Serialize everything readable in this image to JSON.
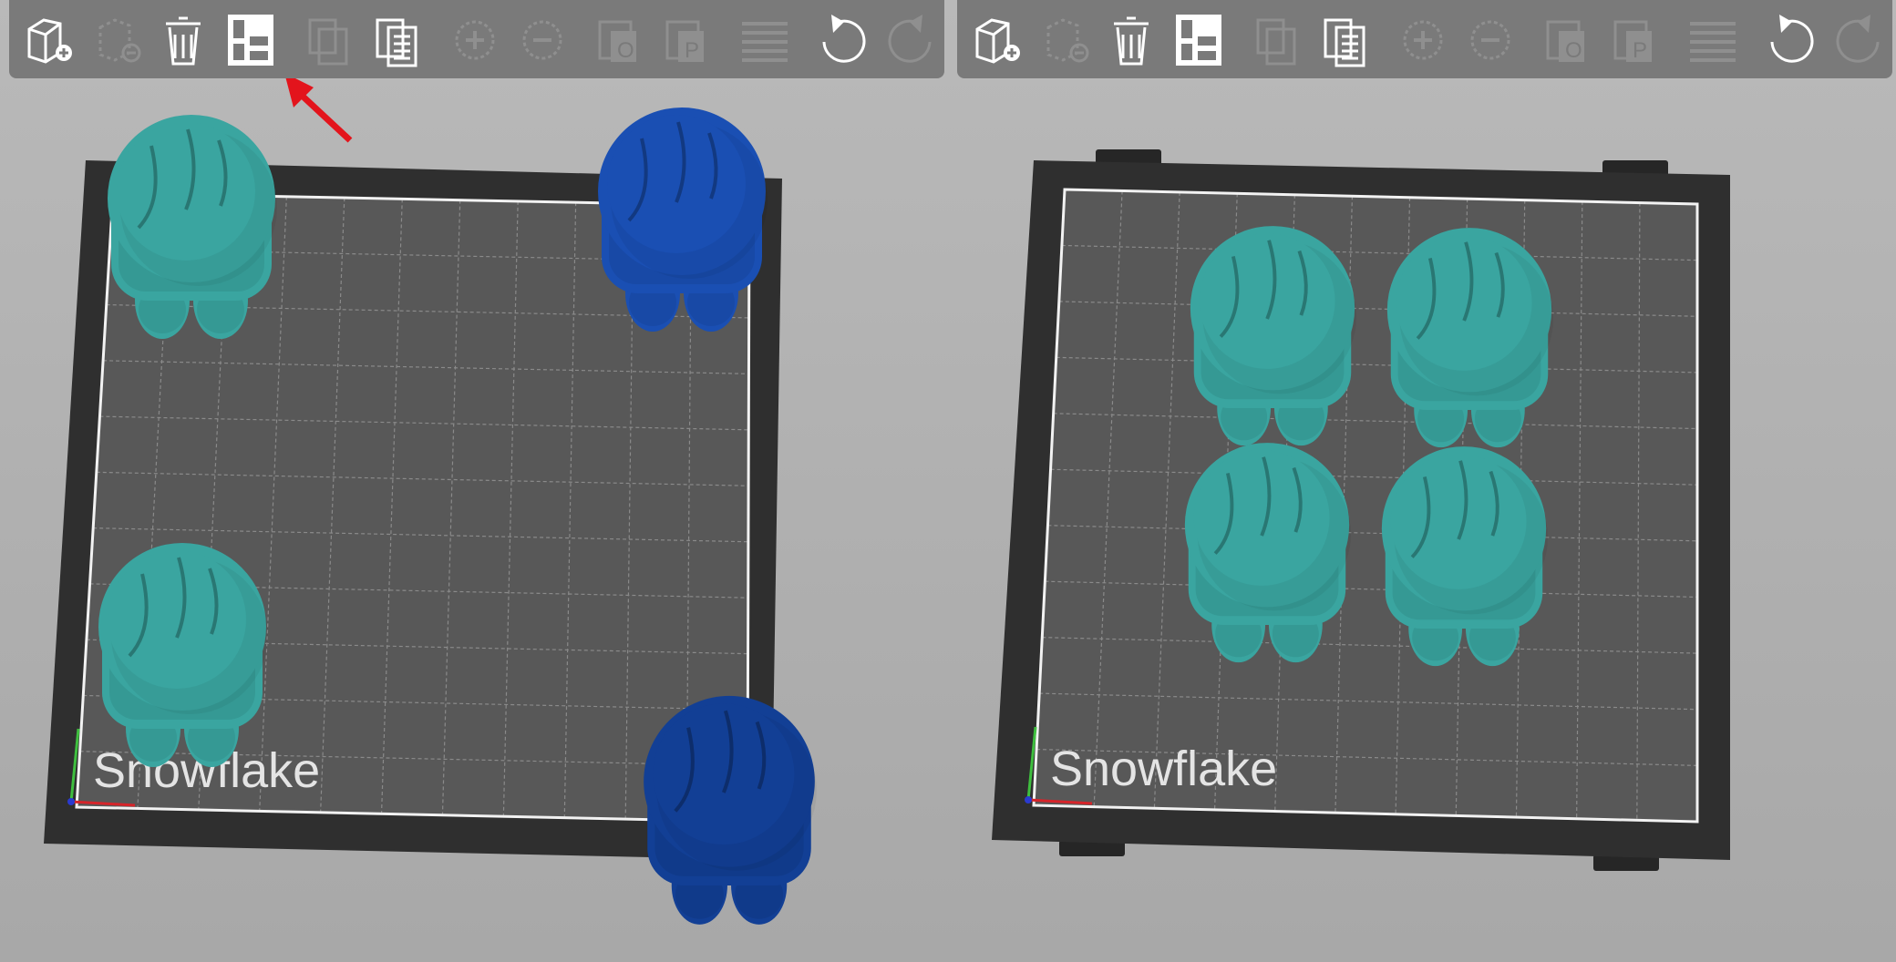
{
  "colors": {
    "background": "#b0b0b0",
    "toolbar": "#7a7a7a",
    "icon_active": "#ffffff",
    "icon_disabled": "#8f8f8f",
    "bed_frame": "#2f2f2f",
    "bed_surface": "#585858",
    "grid": "#8a8a8a",
    "model_teal": "#3aa5a0",
    "model_blue": "#1a4fb3",
    "annotation_arrow": "#e3141c"
  },
  "toolbar_icons": [
    {
      "name": "add-object-icon",
      "enabled": true
    },
    {
      "name": "remove-object-icon",
      "enabled": false
    },
    {
      "name": "delete-all-icon",
      "enabled": true
    },
    {
      "name": "arrange-icon",
      "enabled": true
    },
    {
      "name": "copy-icon",
      "enabled": false
    },
    {
      "name": "paste-icon",
      "enabled": true
    },
    {
      "name": "add-instance-icon",
      "enabled": false
    },
    {
      "name": "remove-instance-icon",
      "enabled": false
    },
    {
      "name": "split-objects-icon",
      "enabled": false
    },
    {
      "name": "split-parts-icon",
      "enabled": false
    },
    {
      "name": "layers-editing-icon",
      "enabled": false
    },
    {
      "name": "undo-icon",
      "enabled": true
    },
    {
      "name": "redo-icon",
      "enabled": false
    }
  ],
  "panels": [
    {
      "id": "before",
      "bed_label": "Snowflake",
      "models": 4,
      "state": "scattered"
    },
    {
      "id": "after",
      "bed_label": "Snowflake",
      "models": 4,
      "state": "arranged"
    }
  ]
}
